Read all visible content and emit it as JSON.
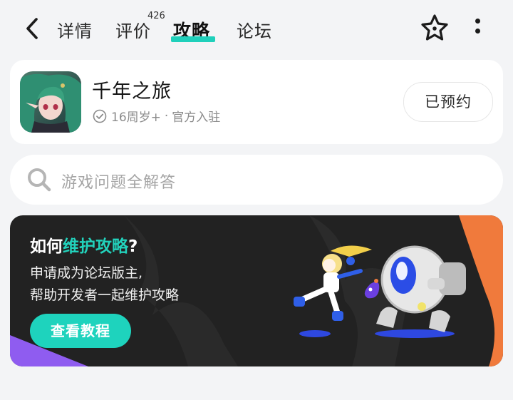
{
  "header": {
    "tabs": [
      {
        "label": "详情"
      },
      {
        "label": "评价",
        "count": "426"
      },
      {
        "label": "攻略",
        "active": true
      },
      {
        "label": "论坛"
      }
    ],
    "icons": {
      "back": "chevron-left-icon",
      "favorite": "star-icon",
      "more": "more-vertical-icon"
    },
    "accent": "#1fd0bb"
  },
  "game": {
    "name": "千年之旅",
    "age_rating": "16周岁+",
    "separator": "·",
    "badge": "官方入驻",
    "reserve_label": "已预约"
  },
  "search": {
    "placeholder": "游戏问题全解答"
  },
  "banner": {
    "title_prefix": "如何",
    "title_highlight": "维护攻略",
    "title_suffix": "?",
    "line1": "申请成为论坛版主,",
    "line2": "帮助开发者一起维护攻略",
    "button_label": "查看教程",
    "colors": {
      "background": "#222222",
      "highlight": "#22d2bc",
      "corner_orange": "#f07a3c",
      "corner_purple": "#8f5cf0"
    }
  }
}
